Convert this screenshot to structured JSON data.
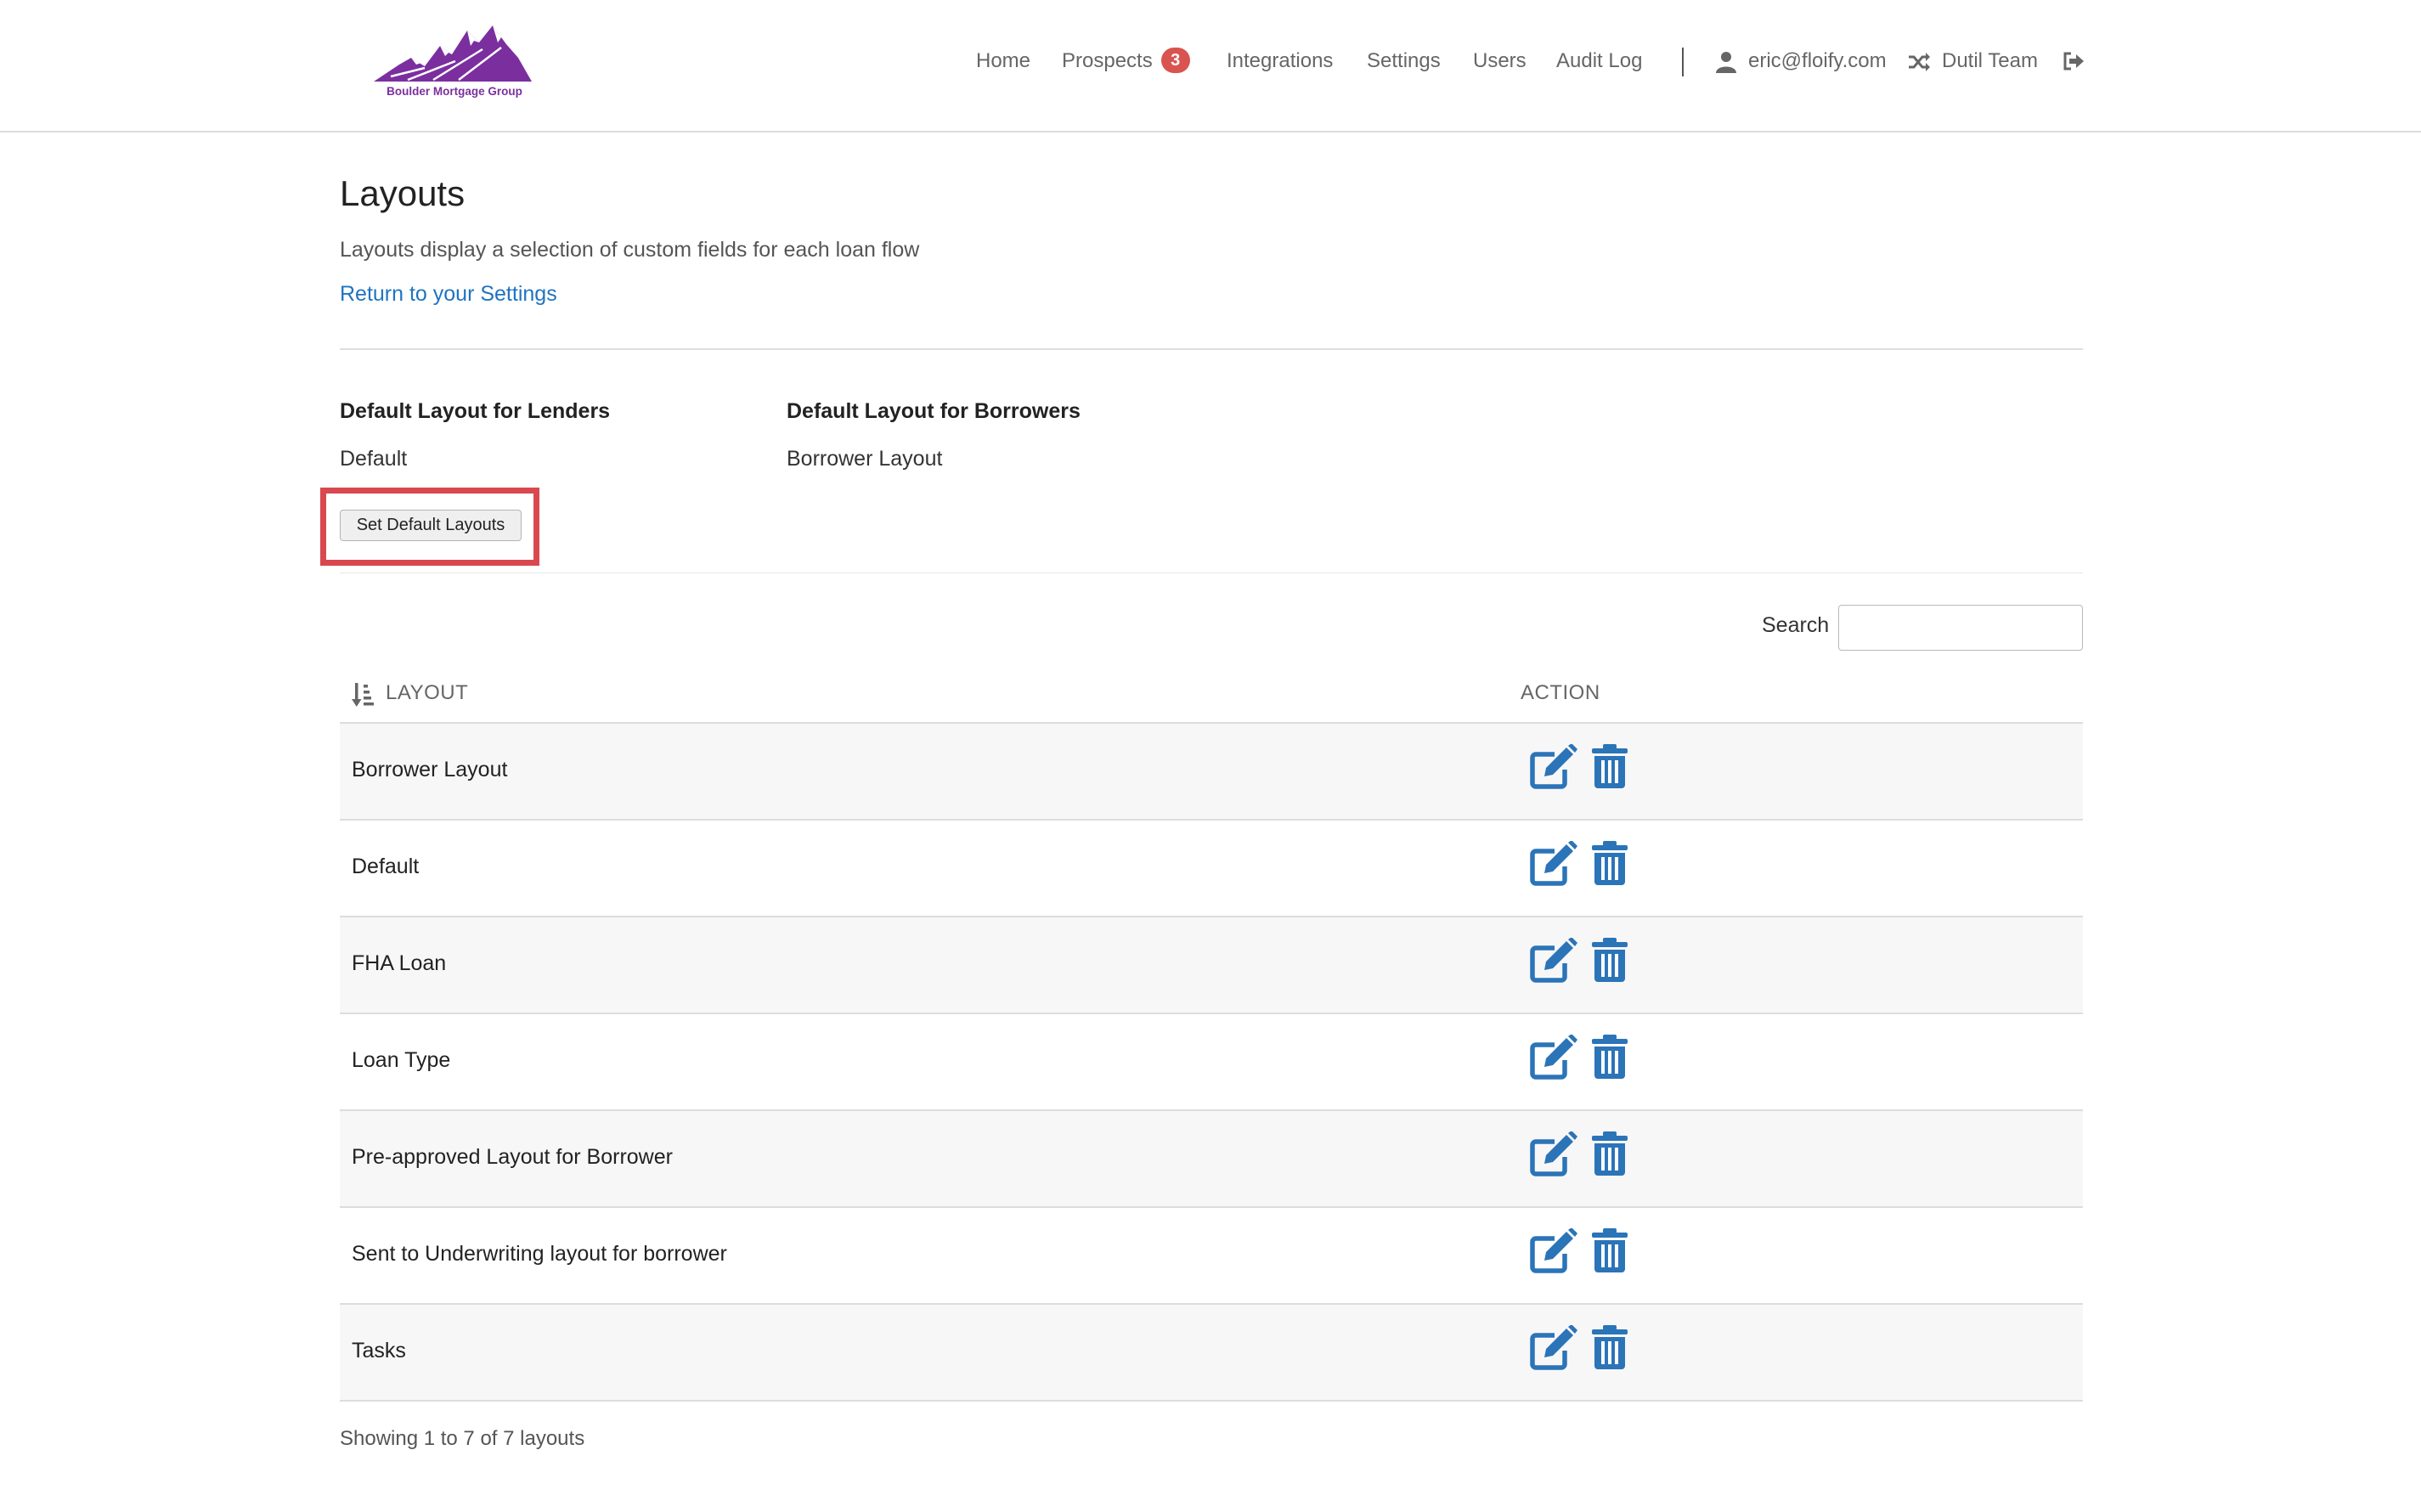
{
  "header": {
    "logo_text": "Boulder Mortgage Group",
    "nav": {
      "home": "Home",
      "prospects": "Prospects",
      "prospects_badge": "3",
      "integrations": "Integrations",
      "settings": "Settings",
      "users": "Users",
      "audit_log": "Audit Log",
      "user_email": "eric@floify.com",
      "team": "Dutil Team"
    }
  },
  "page": {
    "title": "Layouts",
    "description": "Layouts display a selection of custom fields for each loan flow",
    "return_link": "Return to your Settings"
  },
  "defaults": {
    "lenders_heading": "Default Layout for Lenders",
    "lenders_value": "Default",
    "borrowers_heading": "Default Layout for Borrowers",
    "borrowers_value": "Borrower Layout",
    "set_button": "Set Default Layouts"
  },
  "search": {
    "label": "Search",
    "value": ""
  },
  "table": {
    "col_layout": "LAYOUT",
    "col_action": "ACTION",
    "rows": [
      {
        "name": "Borrower Layout"
      },
      {
        "name": "Default"
      },
      {
        "name": "FHA Loan"
      },
      {
        "name": "Loan Type"
      },
      {
        "name": "Pre-approved Layout for Borrower"
      },
      {
        "name": "Sent to Underwriting layout for borrower"
      },
      {
        "name": "Tasks"
      }
    ]
  },
  "footer": {
    "info": "Showing 1 to 7 of 7 layouts"
  },
  "colors": {
    "brand": "#7b2f9f",
    "link": "#1f74c0",
    "action_icon": "#2b74b8",
    "badge": "#d9534f",
    "highlight": "#d9484f"
  },
  "icons": {
    "user": "user-icon",
    "team": "shuffle-icon",
    "logout": "sign-out-icon",
    "sort": "sort-amount-icon",
    "edit": "edit-icon",
    "delete": "trash-icon"
  }
}
